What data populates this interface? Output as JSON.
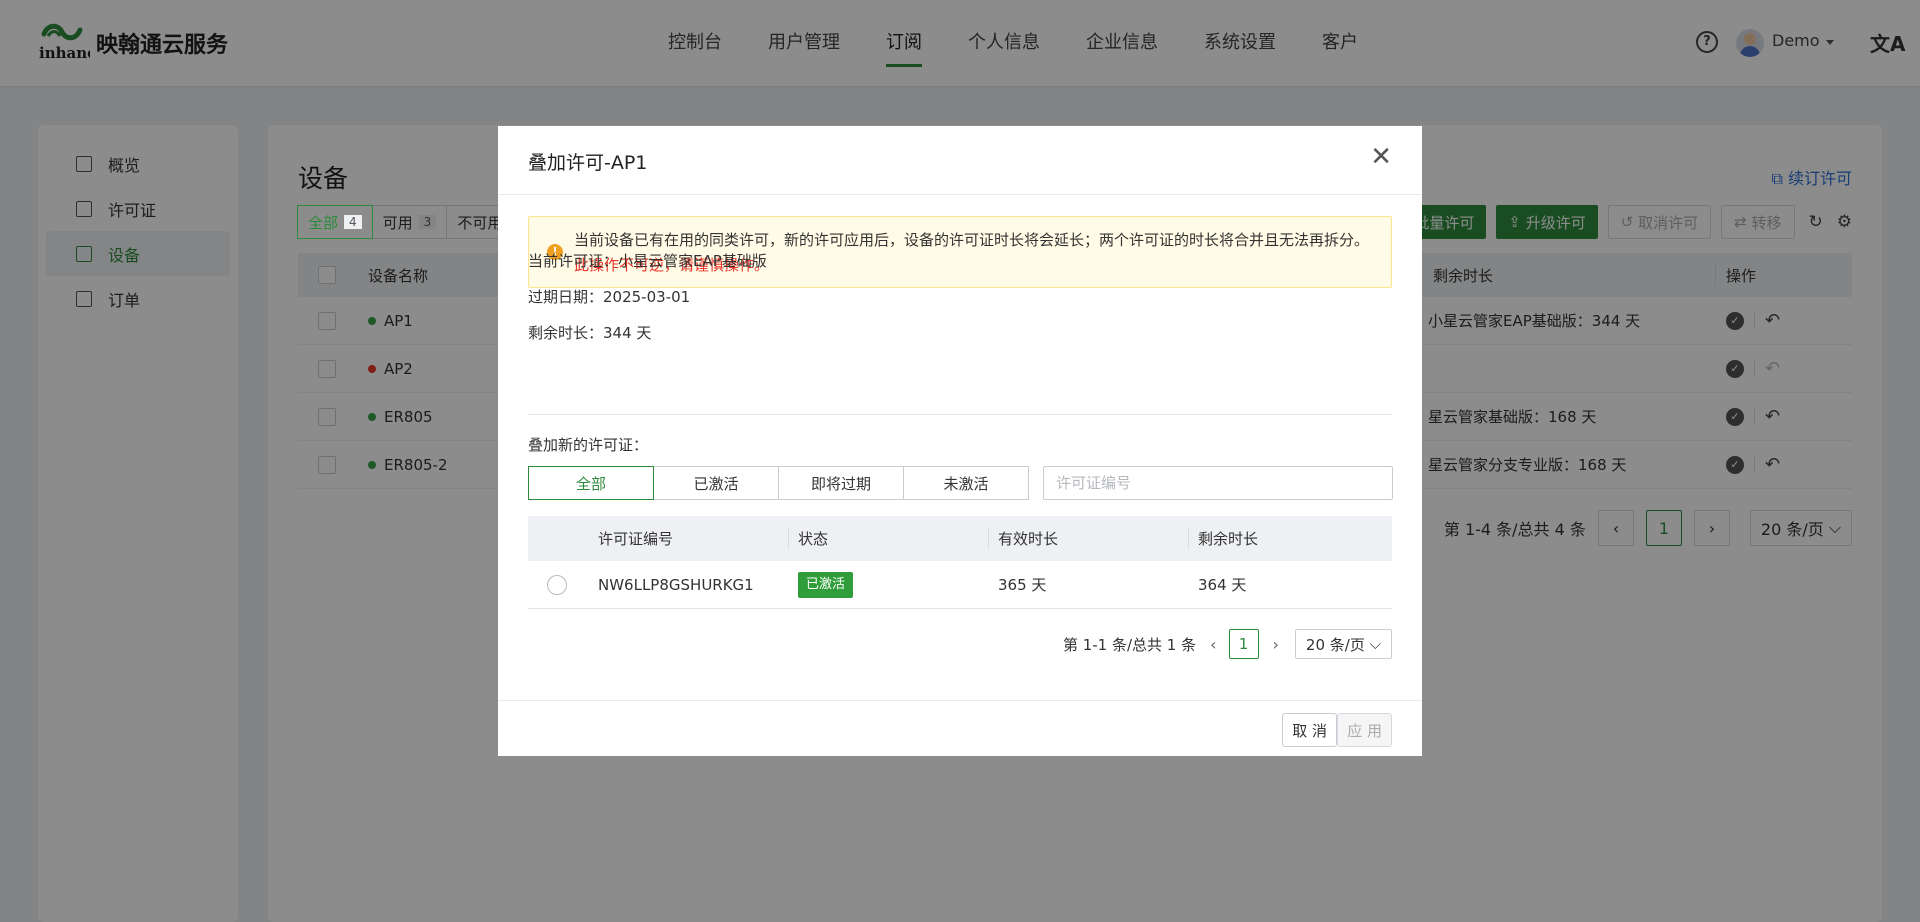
{
  "header": {
    "brand": "映翰通云服务",
    "logo_text": "inhand",
    "nav": [
      "控制台",
      "用户管理",
      "订阅",
      "个人信息",
      "企业信息",
      "系统设置",
      "客户"
    ],
    "active_nav_index": 2,
    "user": "Demo",
    "help_glyph": "?",
    "lang_glyph": "文A"
  },
  "sidebar": {
    "items": [
      "概览",
      "许可证",
      "设备",
      "订单"
    ],
    "active_index": 2
  },
  "content": {
    "title": "设备",
    "renew_link": "续订许可",
    "filter_tabs": [
      {
        "label": "全部",
        "count": "4"
      },
      {
        "label": "可用",
        "count": "3"
      },
      {
        "label": "不可用",
        "count": ""
      }
    ],
    "toolbar": {
      "batch_license": "批量许可",
      "upgrade_license": "升级许可",
      "cancel_license": "取消许可",
      "transfer": "转移"
    },
    "table": {
      "columns": [
        "设备名称",
        "剩余时长",
        "操作"
      ],
      "rows": [
        {
          "name": "AP1",
          "status_color": "#3aa34a",
          "remaining": "小星云管家EAP基础版：344 天",
          "undo_enabled": true
        },
        {
          "name": "AP2",
          "status_color": "#e8352b",
          "remaining": "",
          "undo_enabled": false
        },
        {
          "name": "ER805",
          "status_color": "#3aa34a",
          "remaining": "星云管家基础版：168 天",
          "undo_enabled": true
        },
        {
          "name": "ER805-2",
          "status_color": "#3aa34a",
          "remaining": "星云管家分支专业版：168 天",
          "undo_enabled": true
        }
      ]
    },
    "pager": {
      "summary": "第 1-4 条/总共 4 条",
      "page": "1",
      "page_size": "20 条/页"
    }
  },
  "modal": {
    "title": "叠加许可-AP1",
    "close_glyph": "✕",
    "warning": {
      "text": "当前设备已有在用的同类许可，新的许可应用后，设备的许可证时长将会延长；两个许可证的时长将合并且无法再拆分。",
      "red_text": "此操作不可逆，请谨慎操作。"
    },
    "current_license": "当前许可证：小星云管家EAP基础版",
    "expiry": "过期日期：2025-03-01",
    "remaining": "剩余时长：344 天",
    "stack_label": "叠加新的许可证：",
    "segments": [
      "全部",
      "已激活",
      "即将过期",
      "未激活"
    ],
    "active_segment": 0,
    "search_placeholder": "许可证编号",
    "table": {
      "columns": [
        "许可证编号",
        "状态",
        "有效时长",
        "剩余时长"
      ],
      "rows": [
        {
          "id": "NW6LLP8GSHURKG1",
          "status": "已激活",
          "valid": "365 天",
          "remaining": "364 天"
        }
      ]
    },
    "pager": {
      "summary": "第 1-1 条/总共 1 条",
      "prev": "‹",
      "page": "1",
      "next": "›",
      "page_size": "20 条/页"
    },
    "buttons": {
      "cancel": "取 消",
      "apply": "应 用"
    }
  },
  "colors": {
    "accent": "#2e8b3c",
    "warning_red": "#e8352b",
    "link": "#2a6fd6"
  }
}
